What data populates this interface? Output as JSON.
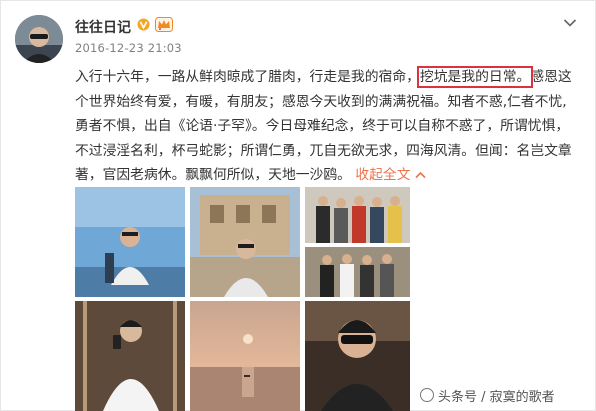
{
  "post": {
    "author": "往往日记",
    "timestamp": "2016-12-23 21:03",
    "text_before": "入行十六年，一路从鲜肉晾成了腊肉，行走是我的宿命，",
    "highlight": "挖坑是我的日常。",
    "text_after": "感恩这个世界始终有爱，有暖，有朋友；感恩今天收到的满满祝福。知者不惑,仁者不忧,勇者不惧，出自《论语·子罕》。今日母难纪念，终于可以自称不惑了，所谓忧惧，不过浸淫名利，杯弓蛇影；所谓仁勇，兀自无欲无求，四海风清。但闻：名岂文章著，官因老病休。飘飘何所似，天地一沙鸥。",
    "expand_label": "收起全文",
    "photo_count": 6
  },
  "icons": {
    "verified": "verified-v-badge-icon",
    "member": "member-crown-icon",
    "menu": "chevron-down-icon",
    "expand": "chevron-up-icon"
  },
  "watermark": {
    "text": "头条号 / 寂寞的歌者"
  },
  "colors": {
    "highlight_border": "#d9333f",
    "link": "#eb7350",
    "verified": "#f5a623",
    "timestamp": "#808080"
  }
}
